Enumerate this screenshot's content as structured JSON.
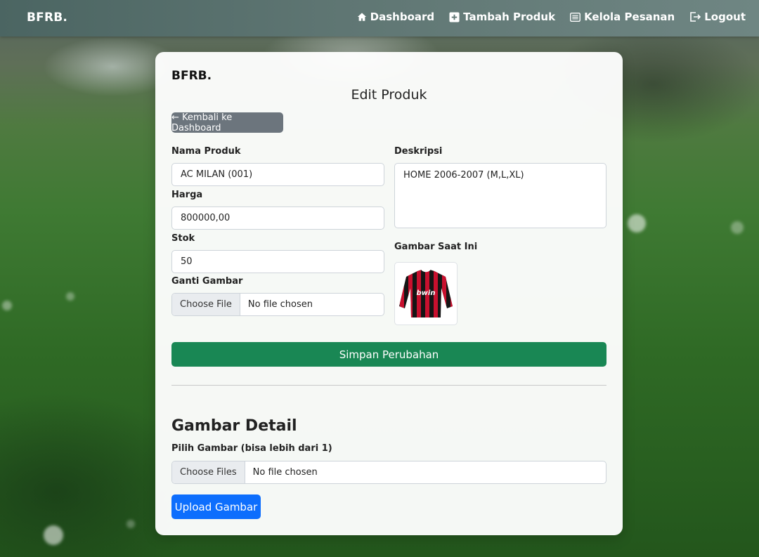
{
  "navbar": {
    "brand": "BFRB.",
    "links": [
      {
        "label": "Dashboard",
        "icon": "home-icon"
      },
      {
        "label": "Tambah Produk",
        "icon": "plus-square-icon"
      },
      {
        "label": "Kelola Pesanan",
        "icon": "list-icon"
      },
      {
        "label": "Logout",
        "icon": "logout-icon"
      }
    ]
  },
  "card": {
    "brand": "BFRB.",
    "title": "Edit Produk",
    "back_button": "← Kembali ke Dashboard"
  },
  "form": {
    "nama_label": "Nama Produk",
    "nama_value": "AC MILAN (001)",
    "harga_label": "Harga",
    "harga_value": "800000,00",
    "stok_label": "Stok",
    "stok_value": "50",
    "ganti_label": "Ganti Gambar",
    "file_button": "Choose File",
    "file_status": "No file chosen",
    "deskripsi_label": "Deskripsi",
    "deskripsi_value": "HOME 2006-2007 (M,L,XL)",
    "current_image_label": "Gambar Saat Ini",
    "current_image_sponsor": "bwin",
    "save_button": "Simpan Perubahan"
  },
  "detail": {
    "title": "Gambar Detail",
    "pick_label": "Pilih Gambar (bisa lebih dari 1)",
    "files_button": "Choose Files",
    "files_status": "No file chosen",
    "upload_button": "Upload Gambar"
  },
  "colors": {
    "save": "#198754",
    "upload": "#0d6efd",
    "back": "#6c757d"
  }
}
